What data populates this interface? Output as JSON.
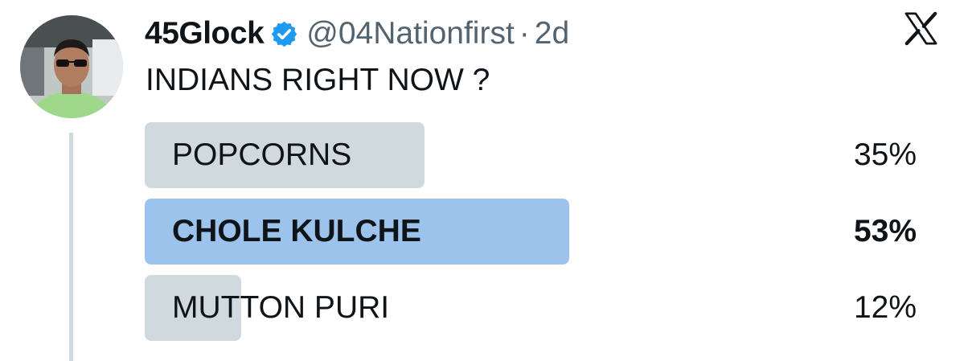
{
  "author": {
    "display_name": "45Glock",
    "handle": "@04Nationfirst",
    "separator": "·",
    "age": "2d",
    "verified_color": "#1d9bf0"
  },
  "tweet": {
    "text": "INDIANS RIGHT NOW ?"
  },
  "poll": {
    "options": [
      {
        "label": "POPCORNS",
        "percent": "35%",
        "value": 0.35,
        "leading": false
      },
      {
        "label": "CHOLE KULCHE",
        "percent": "53%",
        "value": 0.53,
        "leading": true
      },
      {
        "label": "MUTTON PURI",
        "percent": "12%",
        "value": 0.12,
        "leading": false
      }
    ],
    "bar_color": "#cfd9de",
    "leading_bar_color": "#9bc3eb"
  },
  "icons": {
    "avatar": "profile-photo",
    "verified": "verified-badge-icon",
    "platform": "x-logo-icon"
  }
}
